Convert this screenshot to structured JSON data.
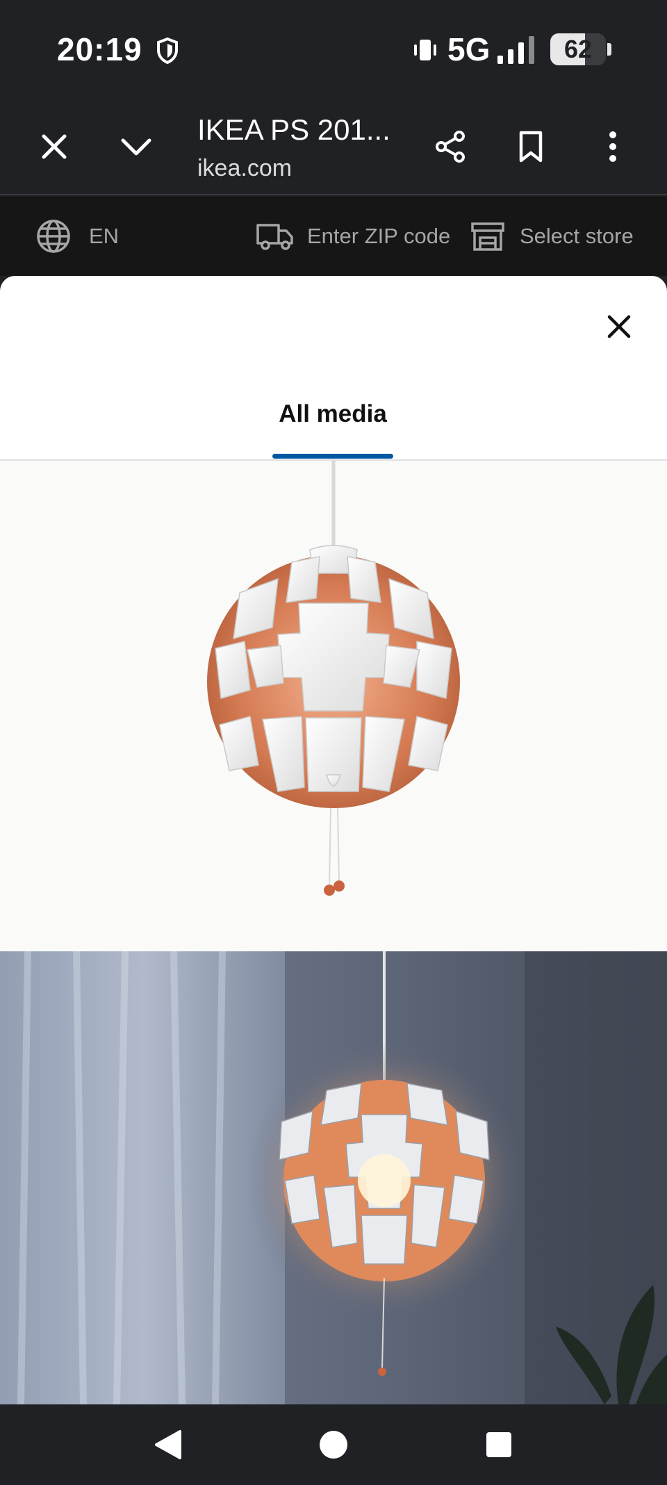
{
  "status_bar": {
    "time": "20:19",
    "network": "5G",
    "battery_percent": "62",
    "battery_level": 0.62,
    "icons": [
      "shield-icon",
      "vibrate-icon",
      "signal-icon",
      "battery-icon"
    ]
  },
  "browser": {
    "tab_title": "IKEA PS 201...",
    "domain": "ikea.com",
    "icons": [
      "close-icon",
      "chevron-down-icon",
      "share-icon",
      "bookmark-icon",
      "more-vert-icon"
    ]
  },
  "site_header": {
    "language": "EN",
    "zip_label": "Enter ZIP code",
    "store_label": "Select store",
    "icons": [
      "globe-icon",
      "truck-icon",
      "store-icon"
    ]
  },
  "media_viewer": {
    "tabs": [
      {
        "label": "All media",
        "active": true
      }
    ],
    "images": [
      "pendant-lamp-product-photo",
      "pendant-lamp-room-photo"
    ],
    "colors": {
      "accent": "#0058a3",
      "copper": "#d9805f"
    }
  },
  "nav_bar": {
    "icons": [
      "back-icon",
      "home-icon",
      "recents-icon"
    ]
  }
}
